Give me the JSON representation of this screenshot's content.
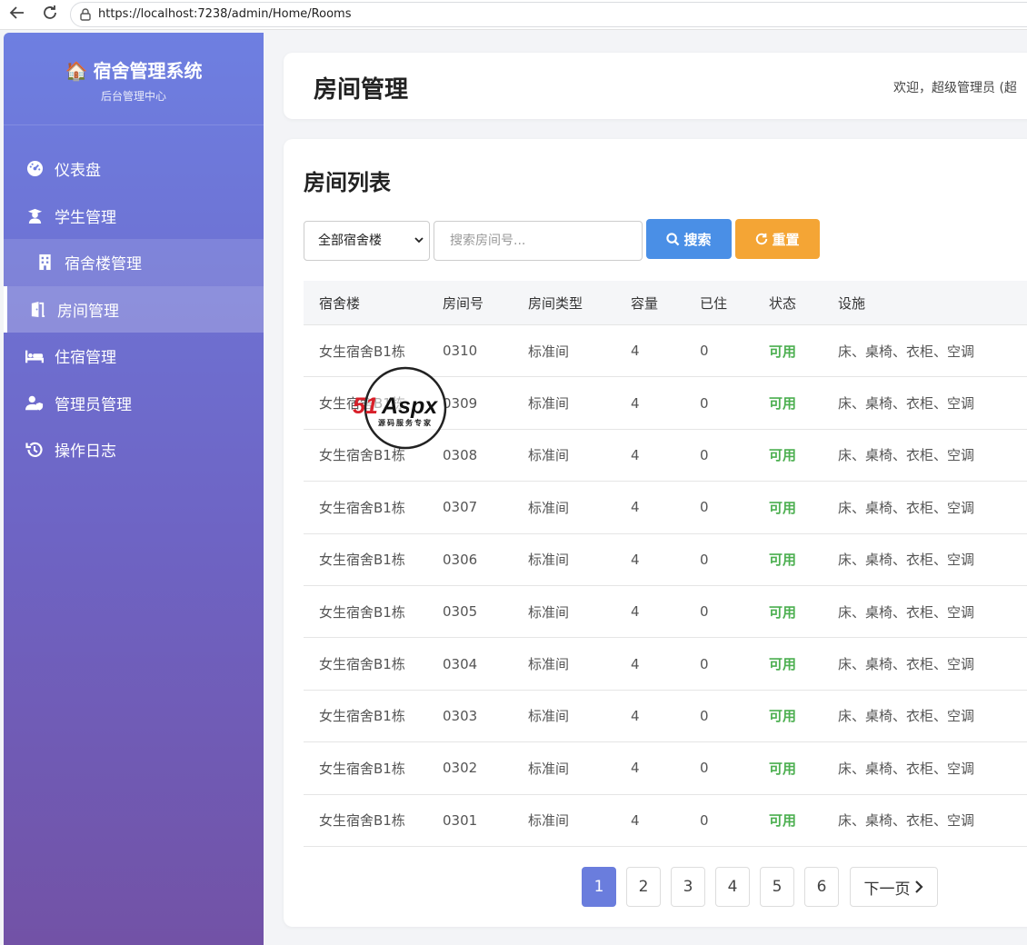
{
  "browser": {
    "url": "https://localhost:7238/admin/Home/Rooms"
  },
  "sidebar": {
    "brand_icon": "🏠",
    "brand_title": "宿舍管理系统",
    "brand_subtitle": "后台管理中心",
    "items": [
      {
        "label": "仪表盘",
        "icon": "dashboard-icon"
      },
      {
        "label": "学生管理",
        "icon": "student-icon"
      },
      {
        "label": "宿舍楼管理",
        "icon": "building-icon"
      },
      {
        "label": "房间管理",
        "icon": "door-icon"
      },
      {
        "label": "住宿管理",
        "icon": "bed-icon"
      },
      {
        "label": "管理员管理",
        "icon": "admin-user-icon"
      },
      {
        "label": "操作日志",
        "icon": "history-icon"
      }
    ]
  },
  "header": {
    "title": "房间管理",
    "welcome": "欢迎，超级管理员 (超"
  },
  "main": {
    "list_title": "房间列表",
    "filter": {
      "building_selected": "全部宿舍楼",
      "search_placeholder": "搜索房间号..."
    },
    "search_label": "搜索",
    "reset_label": "重置",
    "table": {
      "headers": [
        "宿舍楼",
        "房间号",
        "房间类型",
        "容量",
        "已住",
        "状态",
        "设施"
      ],
      "rows": [
        [
          "女生宿舍B1栋",
          "0310",
          "标准间",
          "4",
          "0",
          "可用",
          "床、桌椅、衣柜、空调"
        ],
        [
          "女生宿舍B1栋",
          "0309",
          "标准间",
          "4",
          "0",
          "可用",
          "床、桌椅、衣柜、空调"
        ],
        [
          "女生宿舍B1栋",
          "0308",
          "标准间",
          "4",
          "0",
          "可用",
          "床、桌椅、衣柜、空调"
        ],
        [
          "女生宿舍B1栋",
          "0307",
          "标准间",
          "4",
          "0",
          "可用",
          "床、桌椅、衣柜、空调"
        ],
        [
          "女生宿舍B1栋",
          "0306",
          "标准间",
          "4",
          "0",
          "可用",
          "床、桌椅、衣柜、空调"
        ],
        [
          "女生宿舍B1栋",
          "0305",
          "标准间",
          "4",
          "0",
          "可用",
          "床、桌椅、衣柜、空调"
        ],
        [
          "女生宿舍B1栋",
          "0304",
          "标准间",
          "4",
          "0",
          "可用",
          "床、桌椅、衣柜、空调"
        ],
        [
          "女生宿舍B1栋",
          "0303",
          "标准间",
          "4",
          "0",
          "可用",
          "床、桌椅、衣柜、空调"
        ],
        [
          "女生宿舍B1栋",
          "0302",
          "标准间",
          "4",
          "0",
          "可用",
          "床、桌椅、衣柜、空调"
        ],
        [
          "女生宿舍B1栋",
          "0301",
          "标准间",
          "4",
          "0",
          "可用",
          "床、桌椅、衣柜、空调"
        ]
      ]
    },
    "pagination": {
      "pages": [
        "1",
        "2",
        "3",
        "4",
        "5",
        "6"
      ],
      "current": "1",
      "next_label": "下一页"
    }
  },
  "watermark": {
    "brand": "51Aspx",
    "tagline": "源码服务专家"
  },
  "colors": {
    "accent": "#6a7ddd",
    "search_button": "#4a8fe6",
    "reset_button": "#f4a535",
    "status_ok": "#4caf50"
  }
}
